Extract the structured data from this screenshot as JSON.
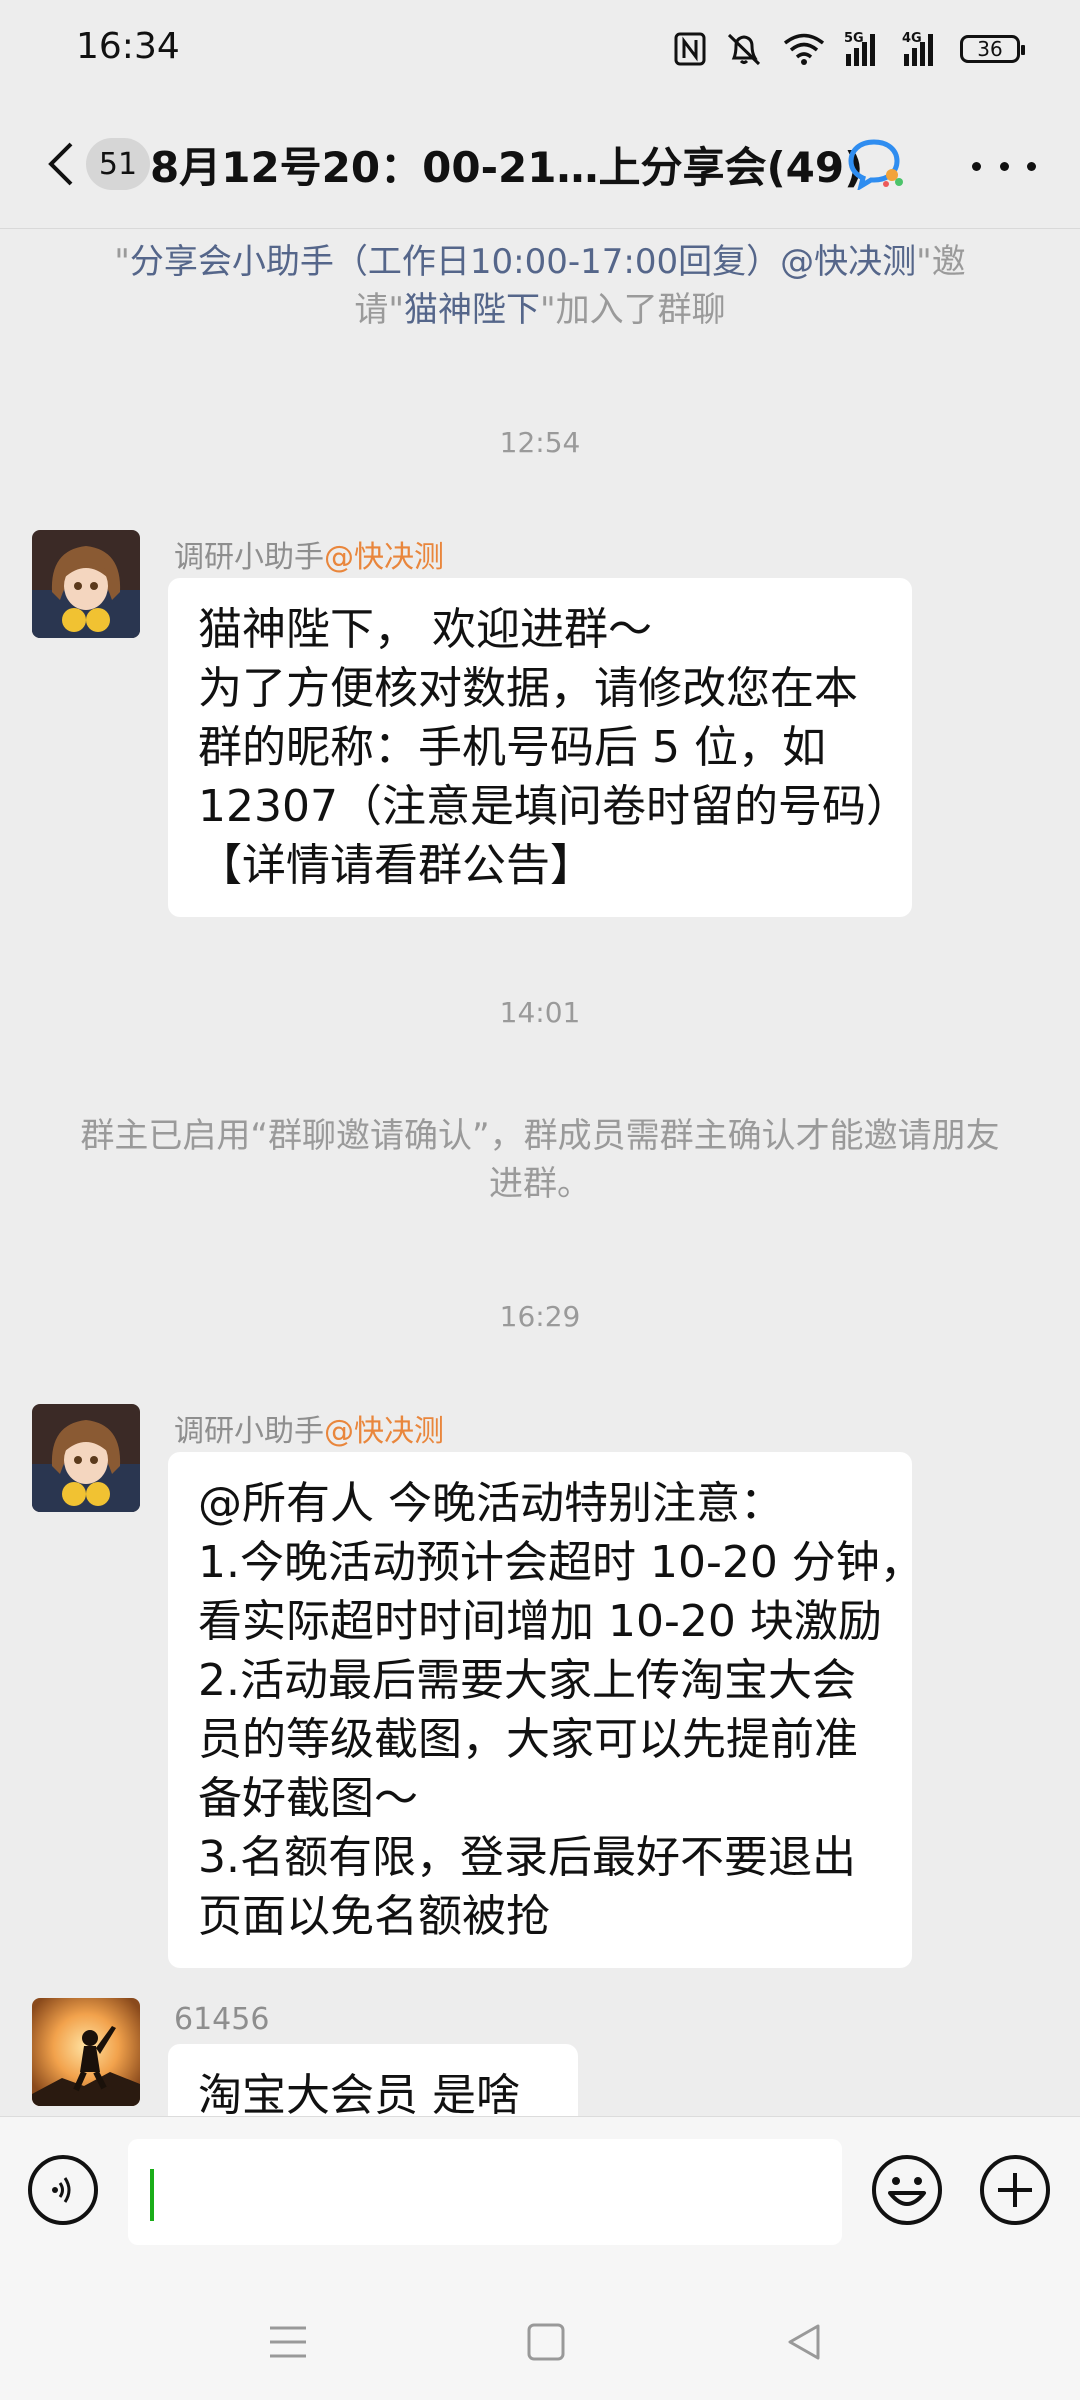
{
  "status_bar": {
    "time": "16:34",
    "icons": [
      "nfc-icon",
      "mute-icon",
      "wifi-icon",
      "signal-5g-icon",
      "signal-4g-icon"
    ],
    "network_5g": "5G",
    "network_4g": "4G",
    "battery": "36"
  },
  "header": {
    "unread_count": "51",
    "title": "8月12号20：00-21…上分享会(49)",
    "more_label": "more"
  },
  "system_messages": {
    "invite": {
      "q1": "\"",
      "inviter": "分享会小助手（工作日10:00-17:00回复）@快决测",
      "mid": "\"邀请\"",
      "invitee": "猫神陛下",
      "end": "\"加入了群聊"
    },
    "confirm_notice": "群主已启用“群聊邀请确认”，群成员需群主确认才能邀请朋友进群。"
  },
  "timestamps": {
    "t1": "12:54",
    "t2": "14:01",
    "t3": "16:29"
  },
  "messages": [
    {
      "sender": "调研小助手",
      "mention": "@快决测",
      "lines": [
        "猫神陛下， 欢迎进群～",
        "为了方便核对数据，请修改您在本",
        "群的昵称：手机号码后 5 位，如",
        "12307（注意是填问卷时留的号码）",
        "【详情请看群公告】"
      ]
    },
    {
      "sender": "调研小助手",
      "mention": "@快决测",
      "lines": [
        "@所有人 今晚活动特别注意：",
        "1.今晚活动预计会超时 10-20 分钟，",
        "看实际超时时间增加 10-20 块激励",
        "2.活动最后需要大家上传淘宝大会",
        "员的等级截图，大家可以先提前准",
        "备好截图～",
        "3.名额有限，登录后最好不要退出",
        "页面以免名额被抢"
      ]
    },
    {
      "sender": "61456",
      "lines": [
        "淘宝大会员 是啥"
      ]
    }
  ],
  "input_bar": {
    "value": "",
    "voice_icon": "voice-icon",
    "emoji_icon": "emoji-icon",
    "plus_icon": "plus-icon"
  },
  "nav_bar": {
    "icons": [
      "menu-icon",
      "home-icon",
      "back-triangle-icon"
    ]
  },
  "colors": {
    "background": "#ededed",
    "mention": "#e9863c",
    "link": "#55668a",
    "cursor": "#1aad19"
  }
}
